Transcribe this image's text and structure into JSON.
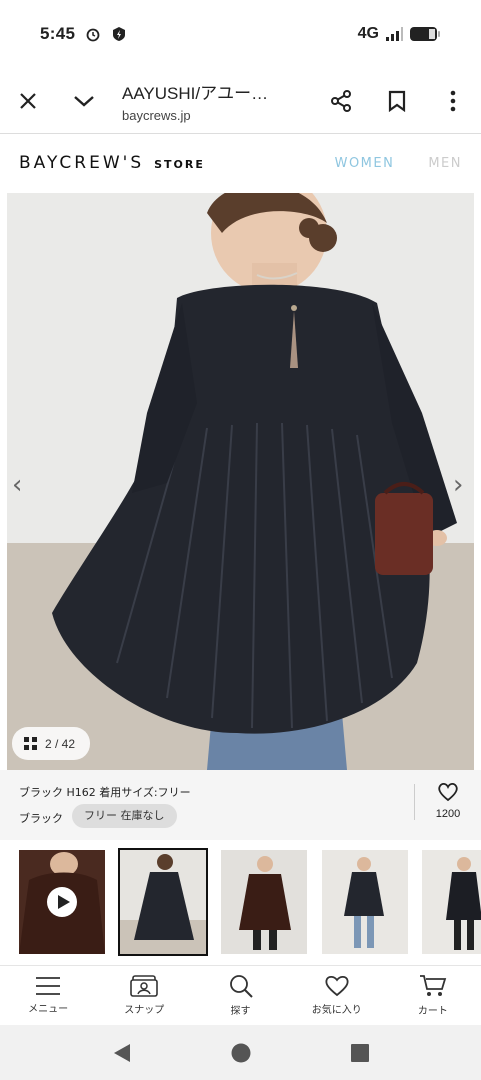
{
  "status": {
    "time": "5:45",
    "network": "4G"
  },
  "browser": {
    "page_title": "AAYUSHI/アユー…",
    "domain": "baycrews.jp"
  },
  "site": {
    "logo": "BAYCREW'S",
    "logo_sub": "STORE",
    "tab_women": "WOMEN",
    "tab_men": "MEN"
  },
  "gallery": {
    "counter": "2 / 42",
    "prev": "‹",
    "next": "›"
  },
  "variant": {
    "color_line": "ブラック H162 着用サイズ:フリー",
    "color_label": "ブラック",
    "size_status": "フリー 在庫なし",
    "favorite_count": "1200"
  },
  "bottom_nav": [
    {
      "label": "メニュー",
      "icon": "menu-icon"
    },
    {
      "label": "スナップ",
      "icon": "snap-icon"
    },
    {
      "label": "探す",
      "icon": "search-icon"
    },
    {
      "label": "お気に入り",
      "icon": "heart-icon"
    },
    {
      "label": "カート",
      "icon": "cart-icon"
    }
  ],
  "colors": {
    "accent_women": "#8fc6e0",
    "dress": "#23262e"
  }
}
